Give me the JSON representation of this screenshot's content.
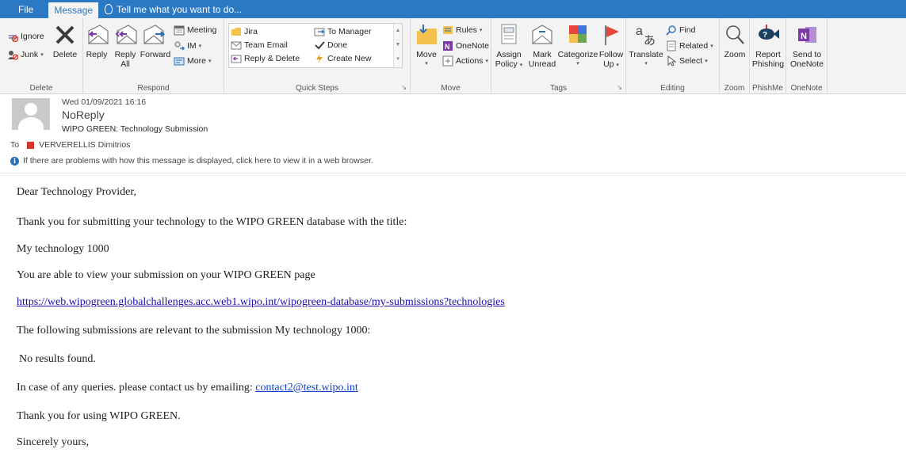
{
  "tabs": {
    "file": "File",
    "message": "Message",
    "tell_me": "Tell me what you want to do..."
  },
  "ribbon": {
    "delete_group": {
      "label": "Delete",
      "ignore": "Ignore",
      "junk": "Junk",
      "delete": "Delete"
    },
    "respond_group": {
      "label": "Respond",
      "reply": "Reply",
      "reply_all_1": "Reply",
      "reply_all_2": "All",
      "forward": "Forward",
      "meeting": "Meeting",
      "im": "IM",
      "more": "More"
    },
    "quick_steps_group": {
      "label": "Quick Steps",
      "items": [
        "Jira",
        "Team Email",
        "Reply & Delete",
        "To Manager",
        "Done",
        "Create New"
      ]
    },
    "move_group": {
      "label": "Move",
      "move": "Move",
      "rules": "Rules",
      "onenote": "OneNote",
      "actions": "Actions"
    },
    "tags_group": {
      "label": "Tags",
      "assign_policy_1": "Assign",
      "assign_policy_2": "Policy",
      "mark_unread_1": "Mark",
      "mark_unread_2": "Unread",
      "categorize": "Categorize",
      "follow_up_1": "Follow",
      "follow_up_2": "Up"
    },
    "editing_group": {
      "label": "Editing",
      "translate": "Translate",
      "find": "Find",
      "related": "Related",
      "select": "Select"
    },
    "zoom_group": {
      "label": "Zoom",
      "zoom": "Zoom"
    },
    "phishme_group": {
      "label": "PhishMe",
      "report_1": "Report",
      "report_2": "Phishing"
    },
    "onenote_group": {
      "label": "OneNote",
      "send_1": "Send to",
      "send_2": "OneNote"
    }
  },
  "message": {
    "date": "Wed 01/09/2021 16:16",
    "from": "NoReply",
    "subject": "WIPO GREEN: Technology Submission",
    "to_label": "To",
    "to_name": "VERVERELLIS Dimitrios",
    "info_bar": "If there are problems with how this message is displayed, click here to view it in a web browser."
  },
  "body": {
    "greeting": "Dear Technology Provider,",
    "line1": "Thank you for submitting your technology to the WIPO GREEN database with the title:",
    "line2": "My technology 1000",
    "line3": "You are able to view your submission on your WIPO GREEN page",
    "link": "https://web.wipogreen.globalchallenges.acc.web1.wipo.int/wipogreen-database/my-submissions?technologies",
    "line4": "The following submissions are relevant to the submission My technology 1000:",
    "line5": "No results found.",
    "line6_prefix": "In case of any queries. please contact us by emailing:",
    "email": "contact2@test.wipo.int",
    "line7": "Thank you for using WIPO GREEN.",
    "line8": "Sincerely yours,"
  },
  "colors": {
    "tab_bar": "#2b79c2",
    "ribbon_bg": "#f3f3f3",
    "link": "#1a0dab",
    "flag_red": "#e8453c",
    "onenote_purple": "#7b3aa6"
  }
}
